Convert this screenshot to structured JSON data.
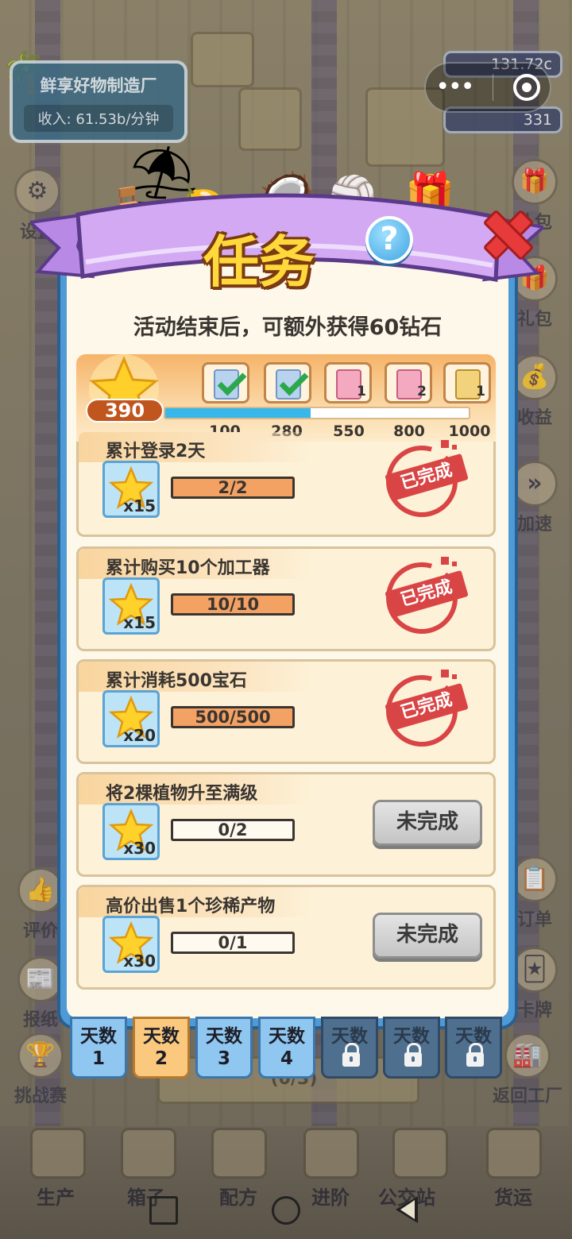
{
  "background": {
    "factory_name": "鲜享好物制造厂",
    "income": "收入: 61.53b/分钟",
    "resource_1": "131.72c",
    "resource_2": "331",
    "left_buttons": [
      "设置",
      "评价",
      "报纸",
      "挑战赛"
    ],
    "right_buttons": [
      "礼包",
      "礼包",
      "收益",
      "加速",
      "订单",
      "卡牌",
      "返回工厂"
    ],
    "bottom_nav": [
      "生产",
      "箱子",
      "配方",
      "进阶",
      "公交站",
      "货运"
    ],
    "under_tabs_counter": "(0/3)"
  },
  "modal": {
    "title": "任务",
    "help_label": "?",
    "subtitle": "活动结束后，可额外获得60钻石",
    "progress": {
      "score": "390",
      "fill_fraction": 0.48,
      "milestones": [
        {
          "tick": "100",
          "card": "blue",
          "claimed": true,
          "count": ""
        },
        {
          "tick": "280",
          "card": "blue",
          "claimed": true,
          "count": ""
        },
        {
          "tick": "550",
          "card": "pink",
          "claimed": false,
          "count": "1"
        },
        {
          "tick": "800",
          "card": "pink",
          "claimed": false,
          "count": "2"
        },
        {
          "tick": "1000",
          "card": "gold",
          "claimed": false,
          "count": "1"
        }
      ]
    },
    "tasks": [
      {
        "title": "累计登录2天",
        "reward": "x15",
        "progress": "2/2",
        "done": true,
        "status": "已完成"
      },
      {
        "title": "累计购买10个加工器",
        "reward": "x15",
        "progress": "10/10",
        "done": true,
        "status": "已完成"
      },
      {
        "title": "累计消耗500宝石",
        "reward": "x20",
        "progress": "500/500",
        "done": true,
        "status": "已完成"
      },
      {
        "title": "将2棵植物升至满级",
        "reward": "x30",
        "progress": "0/2",
        "done": false,
        "status": "未完成"
      },
      {
        "title": "高价出售1个珍稀产物",
        "reward": "x30",
        "progress": "0/1",
        "done": false,
        "status": "未完成"
      }
    ],
    "day_tabs": [
      {
        "label": "天数",
        "num": "1",
        "state": "normal"
      },
      {
        "label": "天数",
        "num": "2",
        "state": "active"
      },
      {
        "label": "天数",
        "num": "3",
        "state": "normal"
      },
      {
        "label": "天数",
        "num": "4",
        "state": "normal"
      },
      {
        "label": "天数",
        "num": "",
        "state": "locked"
      },
      {
        "label": "天数",
        "num": "",
        "state": "locked"
      },
      {
        "label": "天数",
        "num": "",
        "state": "locked"
      }
    ]
  },
  "colors": {
    "accent_blue": "#4e9ad6",
    "done_red": "#d94545",
    "progress_cyan": "#37b7ea",
    "bar_orange": "#f4a164"
  }
}
